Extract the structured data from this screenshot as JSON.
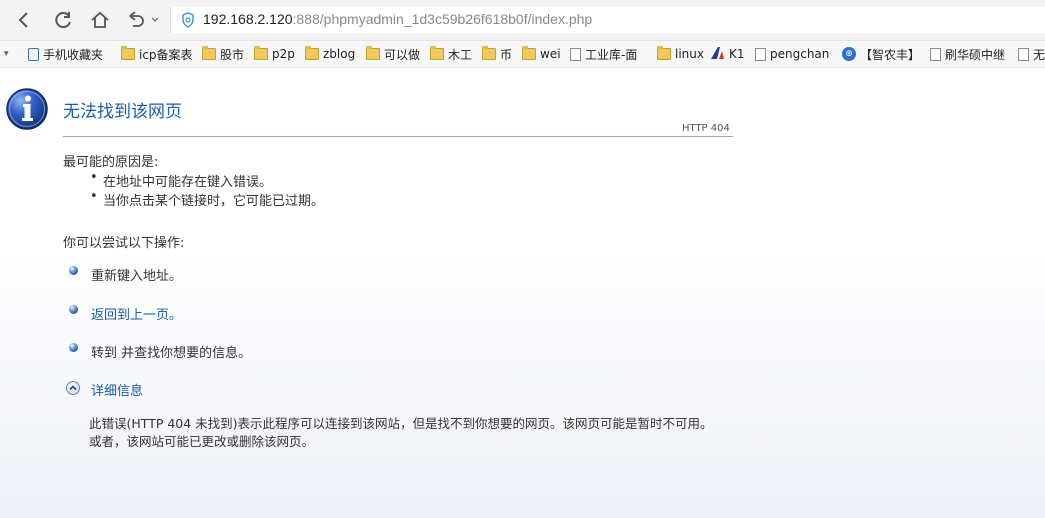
{
  "toolbar": {
    "back_icon": "back-arrow-icon",
    "refresh_icon": "refresh-icon",
    "home_icon": "home-icon",
    "undo_icon": "undo-icon",
    "url_host": "192.168.2.120",
    "url_rest": ":888/phpmyadmin_1d3c59b26f618b0f/index.php"
  },
  "bookmarks": [
    {
      "label": "手机收藏夹",
      "icon": "mobile-icon"
    },
    {
      "label": "icp备案表",
      "icon": "folder-icon"
    },
    {
      "label": "股市",
      "icon": "folder-icon"
    },
    {
      "label": "p2p",
      "icon": "folder-icon"
    },
    {
      "label": "zblog",
      "icon": "folder-icon"
    },
    {
      "label": "可以做",
      "icon": "folder-icon"
    },
    {
      "label": "木工",
      "icon": "folder-icon"
    },
    {
      "label": "币",
      "icon": "folder-icon"
    },
    {
      "label": "wei",
      "icon": "folder-icon"
    },
    {
      "label": "工业库-面",
      "icon": "page-icon"
    },
    {
      "label": "linux",
      "icon": "folder-icon"
    },
    {
      "label": "K1",
      "icon": "k1-logo-icon"
    },
    {
      "label": "pengchan",
      "icon": "page-icon"
    },
    {
      "label": "【智农丰】",
      "icon": "zhinong-icon"
    },
    {
      "label": "刷华硕中继",
      "icon": "page-icon"
    },
    {
      "label": "无",
      "icon": "page-icon"
    }
  ],
  "error": {
    "title": "无法找到该网页",
    "http_code": "HTTP 404",
    "causes_heading": "最可能的原因是:",
    "causes": [
      "在地址中可能存在键入错误。",
      "当你点击某个链接时，它可能已过期。"
    ],
    "try_heading": "你可以尝试以下操作:",
    "actions": [
      "重新键入地址。",
      "返回到上一页。",
      "转到  并查找你想要的信息。"
    ],
    "details_label": "详细信息",
    "details_text_1": "此错误(HTTP 404 未找到)表示此程序可以连接到该网站，但是找不到你想要的网页。该网页可能是暂时不可用。",
    "details_text_2": "或者，该网站可能已更改或删除该网页。"
  },
  "colors": {
    "link": "#1a5aa8",
    "title": "#1f5ca8",
    "folder": "#f1c85a"
  }
}
